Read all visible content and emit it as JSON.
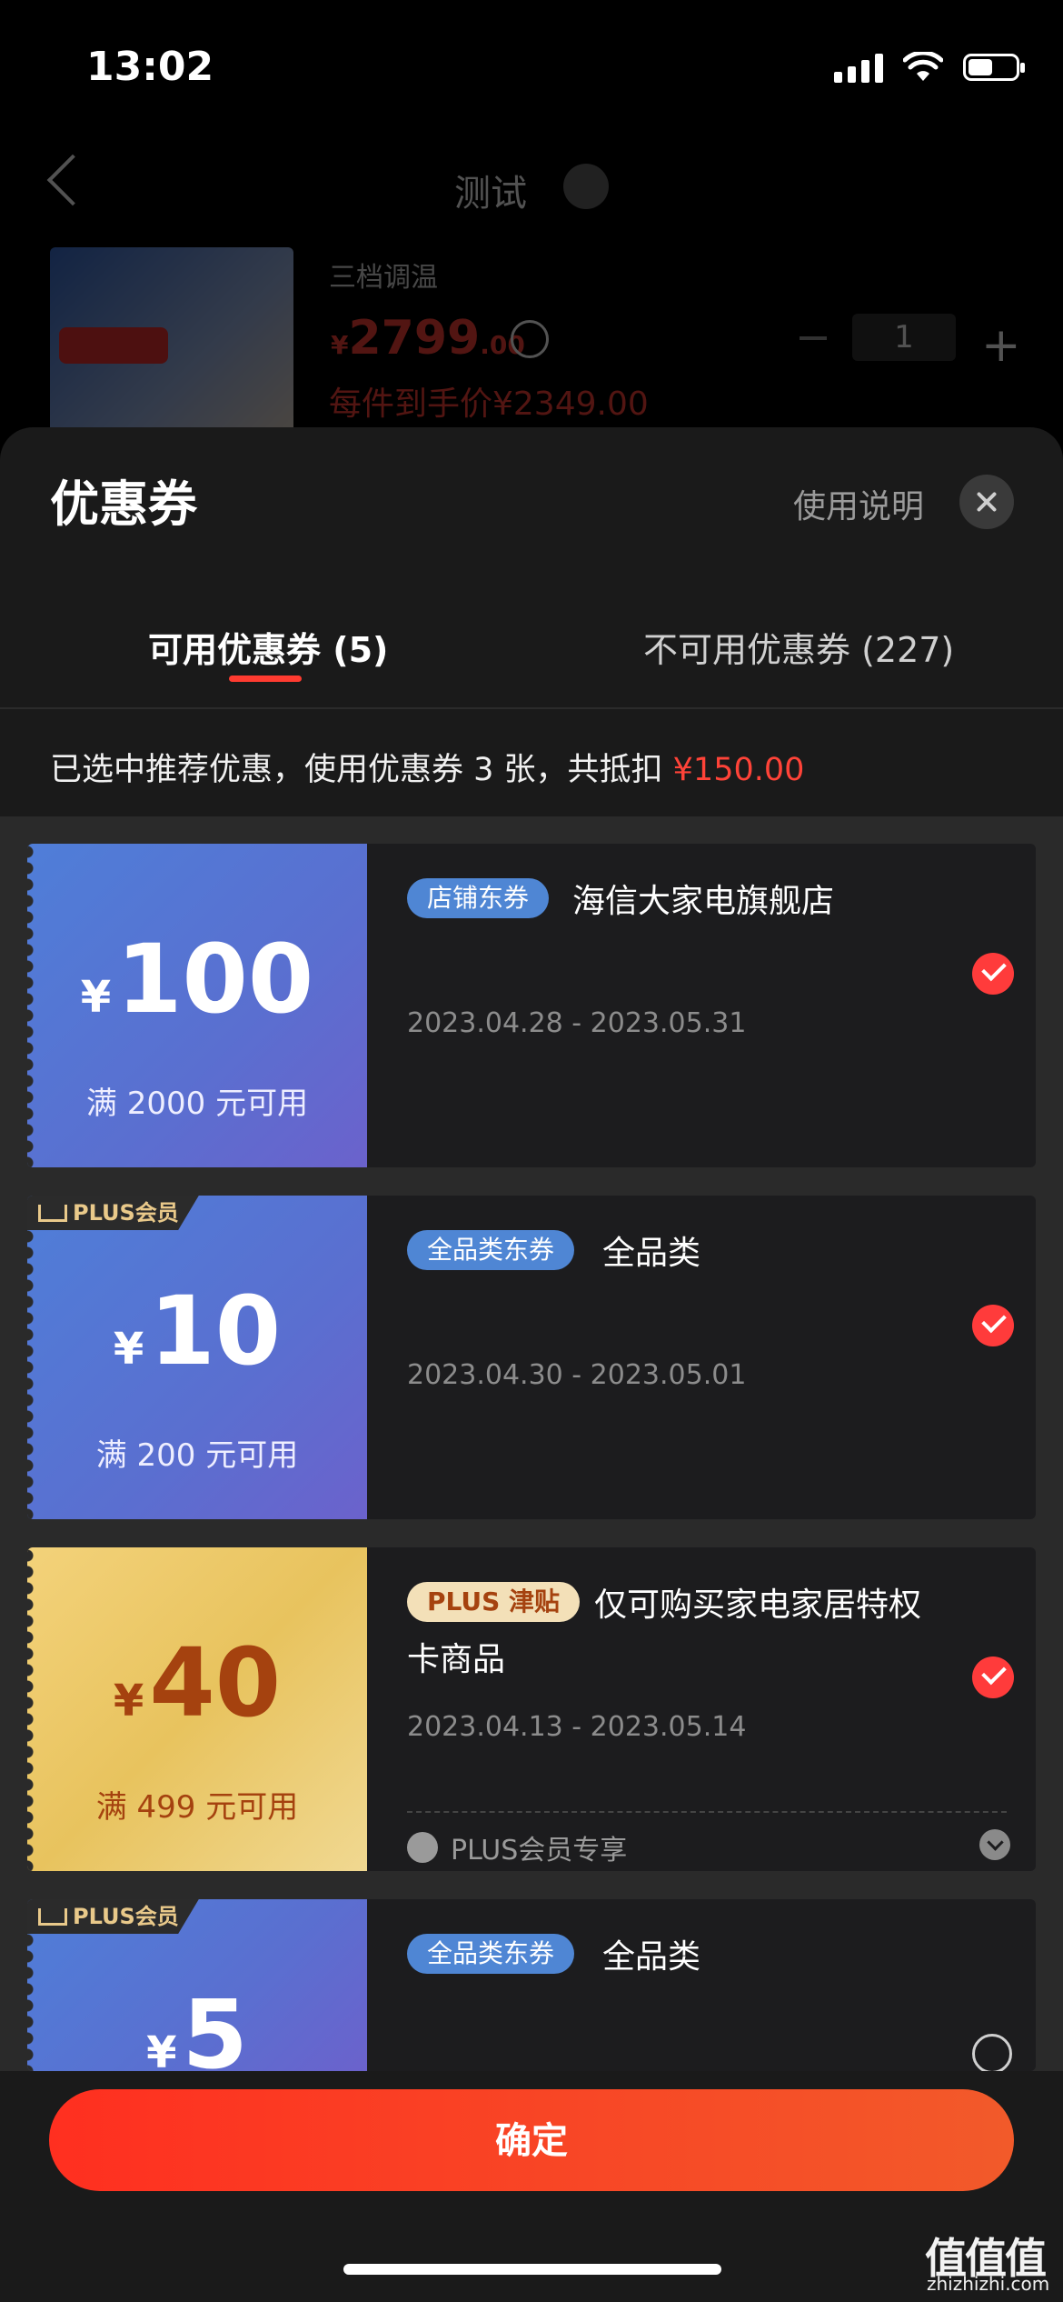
{
  "status": {
    "time": "13:02"
  },
  "background_page": {
    "title": "测试",
    "subtitle": "三档调温",
    "price_yen": "¥",
    "price_main": "2799",
    "price_decimal": ".00",
    "quantity": "1",
    "final_price": "每件到手价¥2349.00"
  },
  "sheet": {
    "title": "优惠券",
    "help_label": "使用说明",
    "tabs": [
      {
        "label": "可用优惠券 (5)"
      },
      {
        "label": "不可用优惠券 (227)"
      }
    ],
    "summary_text": "已选中推荐优惠，使用优惠券 3 张，共抵扣 ",
    "summary_amount": "¥150.00"
  },
  "coupons": [
    {
      "yen": "¥",
      "amount": "100",
      "condition": "满 2000 元可用",
      "badge": "店铺东券",
      "name": "海信大家电旗舰店",
      "date": "2023.04.28 - 2023.05.31",
      "selected": true
    },
    {
      "tag": "PLUS会员",
      "yen": "¥",
      "amount": "10",
      "condition": "满 200 元可用",
      "badge": "全品类东券",
      "name": "全品类",
      "date": "2023.04.30 - 2023.05.01",
      "selected": true
    },
    {
      "yen": "¥",
      "amount": "40",
      "condition": "满 499 元可用",
      "badge": "PLUS 津贴",
      "name_line1": "仅可购买家电家居特权",
      "name_line2": "卡商品",
      "date": "2023.04.13 - 2023.05.14",
      "note": "PLUS会员专享",
      "selected": true
    },
    {
      "tag": "PLUS会员",
      "yen": "¥",
      "amount": "5",
      "badge": "全品类东券",
      "name": "全品类",
      "selected": false
    }
  ],
  "confirm_label": "确定",
  "watermark": {
    "text": "值值值",
    "url": "zhizhizhi.com"
  },
  "colors": {
    "accent": "#ff3b30",
    "sheet_bg": "#1a1a1a",
    "coupon_blue": "#5a6fd0",
    "coupon_gold": "#e8c35e"
  }
}
